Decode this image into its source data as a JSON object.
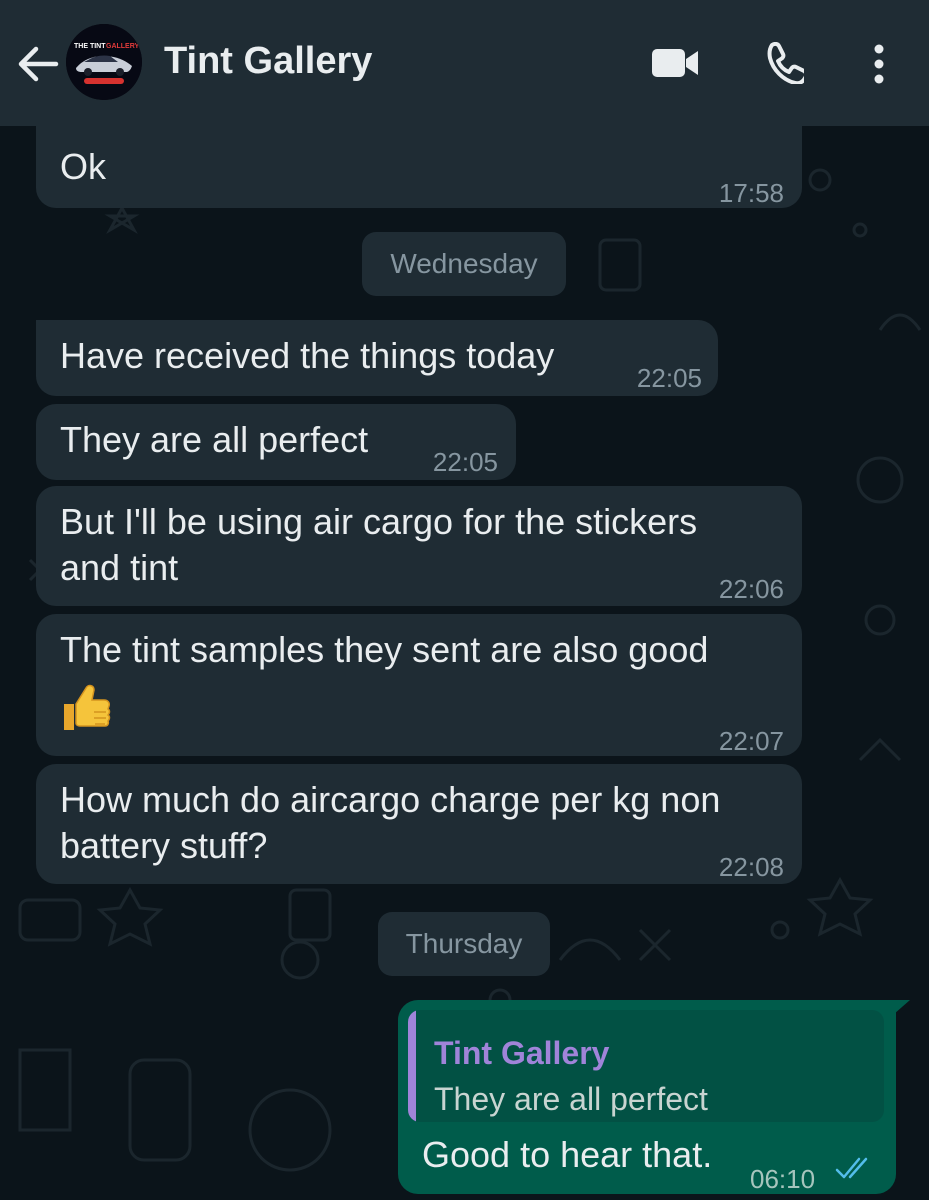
{
  "header": {
    "title": "Tint Gallery",
    "avatar_text": "THE TINT GALLERY"
  },
  "messages": {
    "m0": {
      "text": "Ok",
      "time": "17:58"
    },
    "day1": "Wednesday",
    "m1": {
      "text": "Have received the things today",
      "time": "22:05"
    },
    "m2": {
      "text": "They are all perfect",
      "time": "22:05"
    },
    "m3": {
      "line1": "But I'll be using air cargo for the stickers",
      "line2": "and tint",
      "time": "22:06"
    },
    "m4": {
      "text": "The tint samples they sent are also good",
      "emoji": "thumbs-up",
      "time": "22:07"
    },
    "m5": {
      "line1": "How much do aircargo charge per kg non",
      "line2": "battery stuff?",
      "time": "22:08"
    },
    "day2": "Thursday",
    "reply": {
      "quoted_name": "Tint Gallery",
      "quoted_text": "They are all perfect",
      "text": "Good to hear that.",
      "time": "06:10",
      "status": "read"
    }
  },
  "colors": {
    "background": "#0b141a",
    "header": "#1f2c34",
    "incoming_bubble": "#1f2c34",
    "outgoing_bubble": "#005c4b",
    "read_ticks": "#53bdeb",
    "quote_name": "#a084d9"
  }
}
